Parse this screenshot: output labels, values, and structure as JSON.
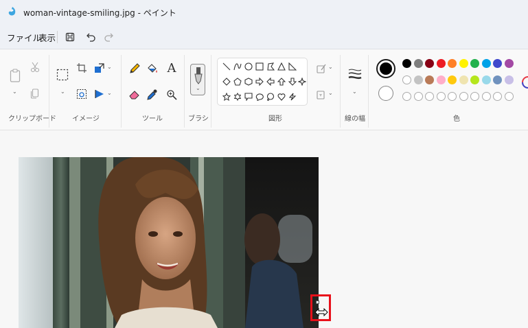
{
  "window": {
    "title": "woman-vintage-smiling.jpg - ペイント"
  },
  "menu": {
    "file": "ファイル",
    "view": "表示"
  },
  "ribbon": {
    "groups": {
      "clipboard": "クリップボード",
      "image": "イメージ",
      "tools": "ツール",
      "brushes": "ブラシ",
      "shapes": "図形",
      "size": "線の幅",
      "colors": "色"
    },
    "text_tool_glyph": "A"
  },
  "colors": {
    "current_primary": "#000000",
    "current_secondary": "#ffffff",
    "row1": [
      "#000000",
      "#7f7f7f",
      "#880015",
      "#ed1c24",
      "#ff7f27",
      "#fff200",
      "#22b14c",
      "#00a2e8",
      "#3f48cc",
      "#a349a4"
    ],
    "row2": [
      "#ffffff",
      "#c3c3c3",
      "#b97a57",
      "#ffaec9",
      "#ffc90e",
      "#efe4b0",
      "#b5e61d",
      "#99d9ea",
      "#7092be",
      "#c8bfe7"
    ]
  },
  "canvas": {
    "image_name": "woman-vintage-smiling.jpg"
  }
}
